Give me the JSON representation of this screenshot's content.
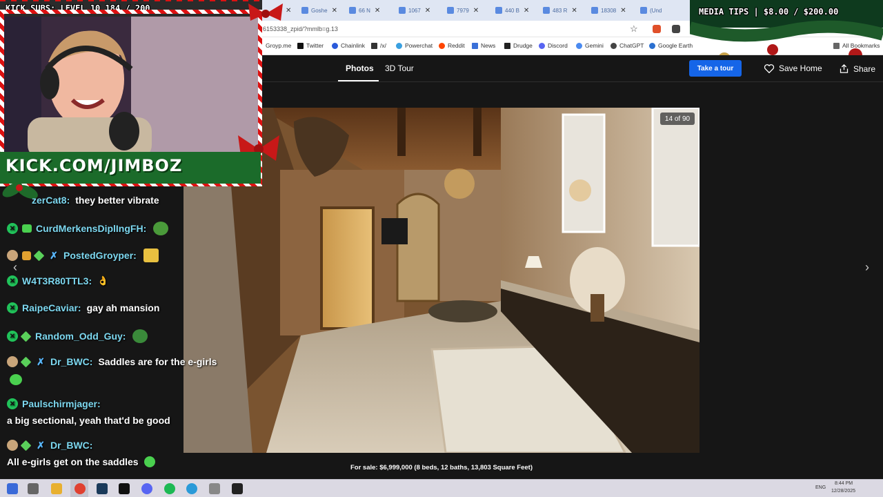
{
  "browser": {
    "tabs": [
      {
        "label": "Goshe"
      },
      {
        "label": "66 N"
      },
      {
        "label": "1067"
      },
      {
        "label": "7979"
      },
      {
        "label": "440 B"
      },
      {
        "label": "483 R"
      },
      {
        "label": "18308"
      },
      {
        "label": "(Und"
      }
    ],
    "url": "6153338_zpid/?mmlb=g.13",
    "bookmarks": [
      "Groyp.me",
      "Twitter",
      "Chainlink",
      "/x/",
      "Powerchat",
      "Reddit",
      "News",
      "Drudge",
      "Discord",
      "Gemini",
      "ChatGPT",
      "Google Earth"
    ],
    "all_bookmarks": "All Bookmarks"
  },
  "site": {
    "tabs": [
      "Photos",
      "3D Tour"
    ],
    "take_tour": "Take a tour",
    "save_home": "Save Home",
    "share": "Share"
  },
  "gallery": {
    "counter": "14 of 90",
    "current_index": 14,
    "total": 90,
    "caption": "For sale: $6,999,000 (8 beds, 12 baths, 13,803 Square Feet)"
  },
  "overlay": {
    "subs": "KICK SUBS: LEVEL 10 184 / 200",
    "kick_url": "KICK.COM/JIMBOZ",
    "media_tips": "MEDIA TIPS | $8.00 / $200.00"
  },
  "chat": [
    {
      "user": "zerCat8:",
      "text": "they better vibrate",
      "badges": []
    },
    {
      "user": "CurdMerkensDiplIngFH:",
      "text": "",
      "badges": [
        "mod",
        "sub"
      ]
    },
    {
      "user": "PostedGroyper:",
      "text": "",
      "badges": [
        "face",
        "gift",
        "diamond",
        "sword"
      ]
    },
    {
      "user": "W4T3R80TTL3:",
      "text": "",
      "badges": [
        "mod"
      ]
    },
    {
      "user": "RaipeCaviar:",
      "text": "gay ah mansion",
      "badges": [
        "mod"
      ]
    },
    {
      "user": "Random_Odd_Guy:",
      "text": "",
      "badges": [
        "mod",
        "diamond"
      ]
    },
    {
      "user": "Dr_BWC:",
      "text": "Saddles are for the e-girls",
      "badges": [
        "face",
        "diamond",
        "sword"
      ]
    },
    {
      "user": "Paulschirmjager:",
      "text": "",
      "badges": [
        "mod"
      ]
    },
    {
      "user": "",
      "text": "a big sectional, yeah that'd be good",
      "badges": []
    },
    {
      "user": "Dr_BWC:",
      "text": "",
      "badges": [
        "face",
        "diamond",
        "sword"
      ]
    },
    {
      "user": "",
      "text": "All e-girls get on the saddles",
      "badges": []
    }
  ],
  "taskbar": {
    "lang": "ENG",
    "time": "8:44 PM",
    "date": "12/28/2025"
  },
  "colors": {
    "accent_blue": "#1565e8",
    "username": "#7dd8f0",
    "mod_green": "#21c35a"
  }
}
